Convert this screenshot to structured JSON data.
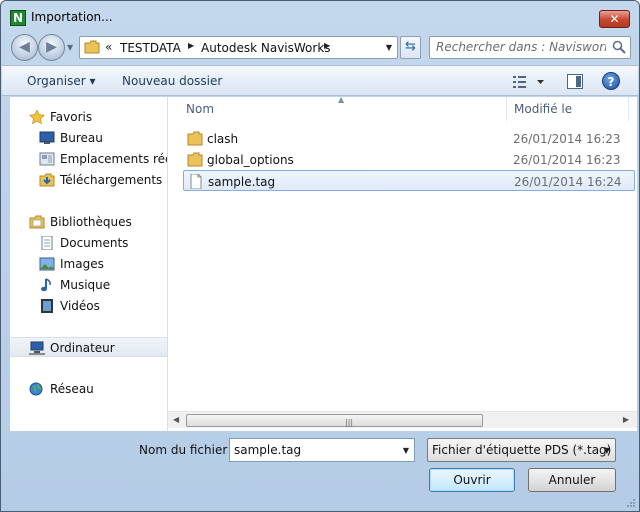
{
  "window": {
    "title": "Importation...",
    "close_label": "✕",
    "app_icon_letter": "N"
  },
  "nav": {
    "address": {
      "prefix": "«",
      "crumbs": [
        "TESTDATA",
        "Autodesk NavisWorks"
      ]
    },
    "search_placeholder": "Rechercher dans : Navisworks"
  },
  "toolbar": {
    "organise_label": "Organiser ▾",
    "new_folder_label": "Nouveau dossier",
    "help_label": "?"
  },
  "sidebar": {
    "items": [
      {
        "label": "Favoris",
        "icon": "star-icon"
      },
      {
        "label": "Bureau",
        "icon": "desktop-icon"
      },
      {
        "label": "Emplacements récents",
        "icon": "recent-places-icon"
      },
      {
        "label": "Téléchargements",
        "icon": "downloads-icon"
      },
      {
        "label": "Bibliothèques",
        "icon": "libraries-icon"
      },
      {
        "label": "Documents",
        "icon": "documents-icon"
      },
      {
        "label": "Images",
        "icon": "images-icon"
      },
      {
        "label": "Musique",
        "icon": "music-icon"
      },
      {
        "label": "Vidéos",
        "icon": "videos-icon"
      },
      {
        "label": "Ordinateur",
        "icon": "computer-icon"
      },
      {
        "label": "Réseau",
        "icon": "network-icon"
      }
    ]
  },
  "files": {
    "columns": {
      "name": "Nom",
      "date": "Modifié le"
    },
    "rows": [
      {
        "name": "clash",
        "date": "26/01/2014 16:23",
        "type": "folder"
      },
      {
        "name": "global_options",
        "date": "26/01/2014 16:23",
        "type": "folder"
      },
      {
        "name": "sample.tag",
        "date": "26/01/2014 16:24",
        "type": "file"
      }
    ]
  },
  "bottom": {
    "filename_label": "Nom du fichier :",
    "filename_value": "sample.tag",
    "filetype_value": "Fichier d'étiquette PDS (*.tag)",
    "open_label": "Ouvrir",
    "cancel_label": "Annuler"
  },
  "colors": {
    "accent": "#3c7fb1",
    "frame": "#bcd2ea",
    "selected_row": "#dfeafb"
  }
}
